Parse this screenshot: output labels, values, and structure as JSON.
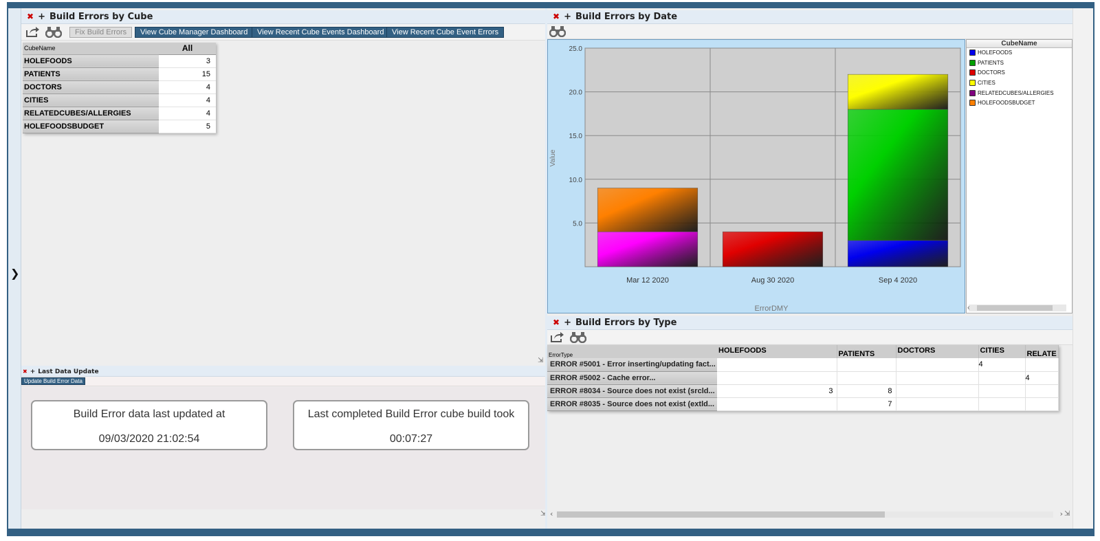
{
  "sidebar": {
    "toggle_icon": "chevron-right-icon"
  },
  "cube_panel": {
    "title": "Build Errors by Cube",
    "buttons": {
      "fix": "Fix Build Errors",
      "cube_manager": "View Cube Manager Dashboard",
      "recent_events": "View Recent Cube Events Dashboard",
      "recent_errors": "View Recent Cube Event Errors"
    },
    "table": {
      "row_header": "CubeName",
      "col_header": "All",
      "rows": [
        {
          "label": "HOLEFOODS",
          "value": "3"
        },
        {
          "label": "PATIENTS",
          "value": "15"
        },
        {
          "label": "DOCTORS",
          "value": "4"
        },
        {
          "label": "CITIES",
          "value": "4"
        },
        {
          "label": "RELATEDCUBES/ALLERGIES",
          "value": "4"
        },
        {
          "label": "HOLEFOODSBUDGET",
          "value": "5"
        }
      ]
    }
  },
  "date_panel": {
    "title": "Build Errors by Date",
    "legend_title": "CubeName",
    "legend": [
      {
        "label": "HOLEFOODS",
        "color": "#0000ee"
      },
      {
        "label": "PATIENTS",
        "color": "#00a000"
      },
      {
        "label": "DOCTORS",
        "color": "#e00000"
      },
      {
        "label": "CITIES",
        "color": "#ffff00"
      },
      {
        "label": "RELATEDCUBES/ALLERGIES",
        "color": "#800080"
      },
      {
        "label": "HOLEFOODSBUDGET",
        "color": "#ff8000"
      }
    ]
  },
  "chart_data": {
    "type": "bar",
    "stacked": true,
    "categories": [
      "Mar 12 2020",
      "Aug 30 2020",
      "Sep 4 2020"
    ],
    "series": [
      {
        "name": "HOLEFOODS",
        "color": "#0000ee",
        "values": [
          0,
          0,
          3
        ]
      },
      {
        "name": "PATIENTS",
        "color": "#00d000",
        "values": [
          0,
          0,
          15
        ]
      },
      {
        "name": "DOCTORS",
        "color": "#e00000",
        "values": [
          0,
          4,
          0
        ]
      },
      {
        "name": "CITIES",
        "color": "#ffff00",
        "values": [
          0,
          0,
          4
        ]
      },
      {
        "name": "RELATEDCUBES/ALLERGIES",
        "color": "#ff00ff",
        "values": [
          4,
          0,
          0
        ]
      },
      {
        "name": "HOLEFOODSBUDGET",
        "color": "#ff8000",
        "values": [
          5,
          0,
          0
        ]
      }
    ],
    "yticks": [
      "5.0",
      "10.0",
      "15.0",
      "20.0",
      "25.0"
    ],
    "ylim": [
      0,
      25
    ],
    "xlabel": "ErrorDMY",
    "ylabel": "Value",
    "grid": true
  },
  "type_panel": {
    "title": "Build Errors by Type",
    "row_header": "ErrorType",
    "columns": [
      "HOLEFOODS",
      "PATIENTS",
      "DOCTORS",
      "CITIES",
      "RELATE"
    ],
    "rows": [
      {
        "label": "ERROR #5001 - Error inserting/updating fact...",
        "values": [
          "",
          "",
          "",
          "4",
          ""
        ]
      },
      {
        "label": "ERROR #5002 - Cache error...",
        "values": [
          "",
          "",
          "",
          "",
          "4"
        ]
      },
      {
        "label": "ERROR #8034 - Source does not exist (srcld...",
        "values": [
          "3",
          "8",
          "",
          "",
          ""
        ]
      },
      {
        "label": "ERROR #8035 - Source does not exist (extld...",
        "values": [
          "",
          "7",
          "",
          "",
          ""
        ]
      }
    ]
  },
  "last_update_panel": {
    "title": "Last Data Update",
    "button": "Update Build Error Data",
    "card1": {
      "line1": "Build Error data last updated at",
      "line2": "09/03/2020 21:02:54"
    },
    "card2": {
      "line1": "Last completed Build Error cube build took",
      "line2": "00:07:27"
    }
  }
}
